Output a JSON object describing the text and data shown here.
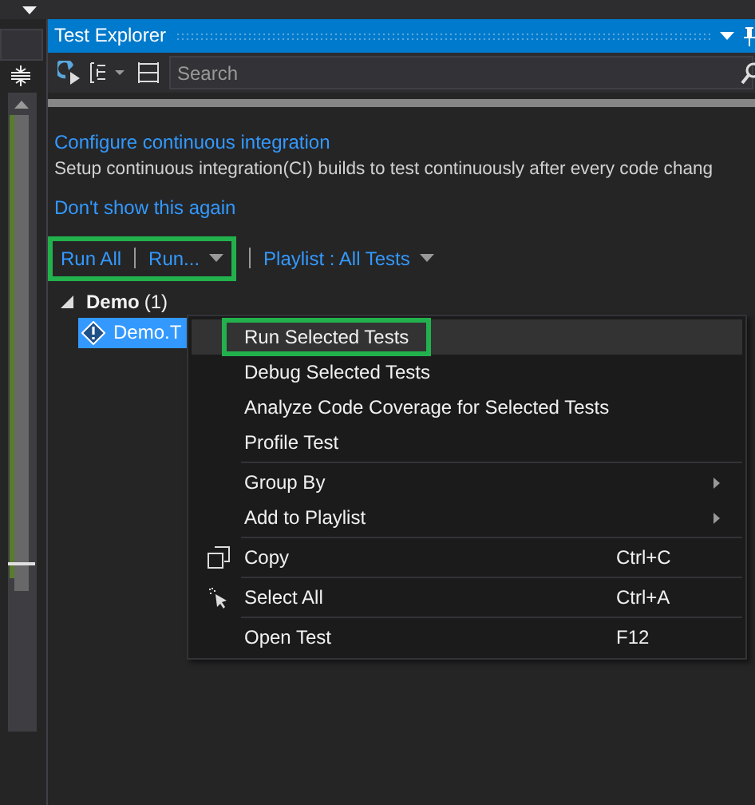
{
  "panel": {
    "title": "Test Explorer"
  },
  "search": {
    "placeholder": "Search"
  },
  "notice": {
    "link": "Configure continuous integration",
    "text": "Setup continuous integration(CI) builds to test continuously after every code chang",
    "dismiss": "Don't show this again"
  },
  "commands": [
    {
      "label": "Run All",
      "dropdown": false,
      "highlighted": true
    },
    {
      "label": "Run...",
      "dropdown": true,
      "highlighted": true
    },
    {
      "label": "Playlist : All Tests",
      "dropdown": true,
      "highlighted": false
    }
  ],
  "tree": [
    {
      "label": "Demo",
      "count": "(1)",
      "expanded": true,
      "children": [
        {
          "label": "Demo.T",
          "selected": true
        }
      ]
    }
  ],
  "context_menu": [
    {
      "kind": "item",
      "label": "Run Selected Tests",
      "selected": true,
      "highlighted": true
    },
    {
      "kind": "item",
      "label": "Debug Selected Tests",
      "selected": false,
      "highlighted": false
    },
    {
      "kind": "item",
      "label": "Analyze Code Coverage for Selected Tests",
      "selected": false,
      "highlighted": false
    },
    {
      "kind": "item",
      "label": "Profile Test",
      "selected": false,
      "highlighted": false
    },
    {
      "kind": "separator"
    },
    {
      "kind": "submenu",
      "label": "Group By",
      "selected": false,
      "highlighted": false
    },
    {
      "kind": "submenu",
      "label": "Add to Playlist",
      "selected": false,
      "highlighted": false
    },
    {
      "kind": "separator"
    },
    {
      "kind": "copy",
      "label": "Copy",
      "shortcut": "Ctrl+C",
      "selected": false,
      "highlighted": false
    },
    {
      "kind": "separator"
    },
    {
      "kind": "selectall",
      "label": "Select All",
      "shortcut": "Ctrl+A",
      "selected": false,
      "highlighted": false
    },
    {
      "kind": "separator"
    },
    {
      "kind": "item",
      "label": "Open Test",
      "shortcut": "F12",
      "selected": false,
      "highlighted": false
    }
  ]
}
